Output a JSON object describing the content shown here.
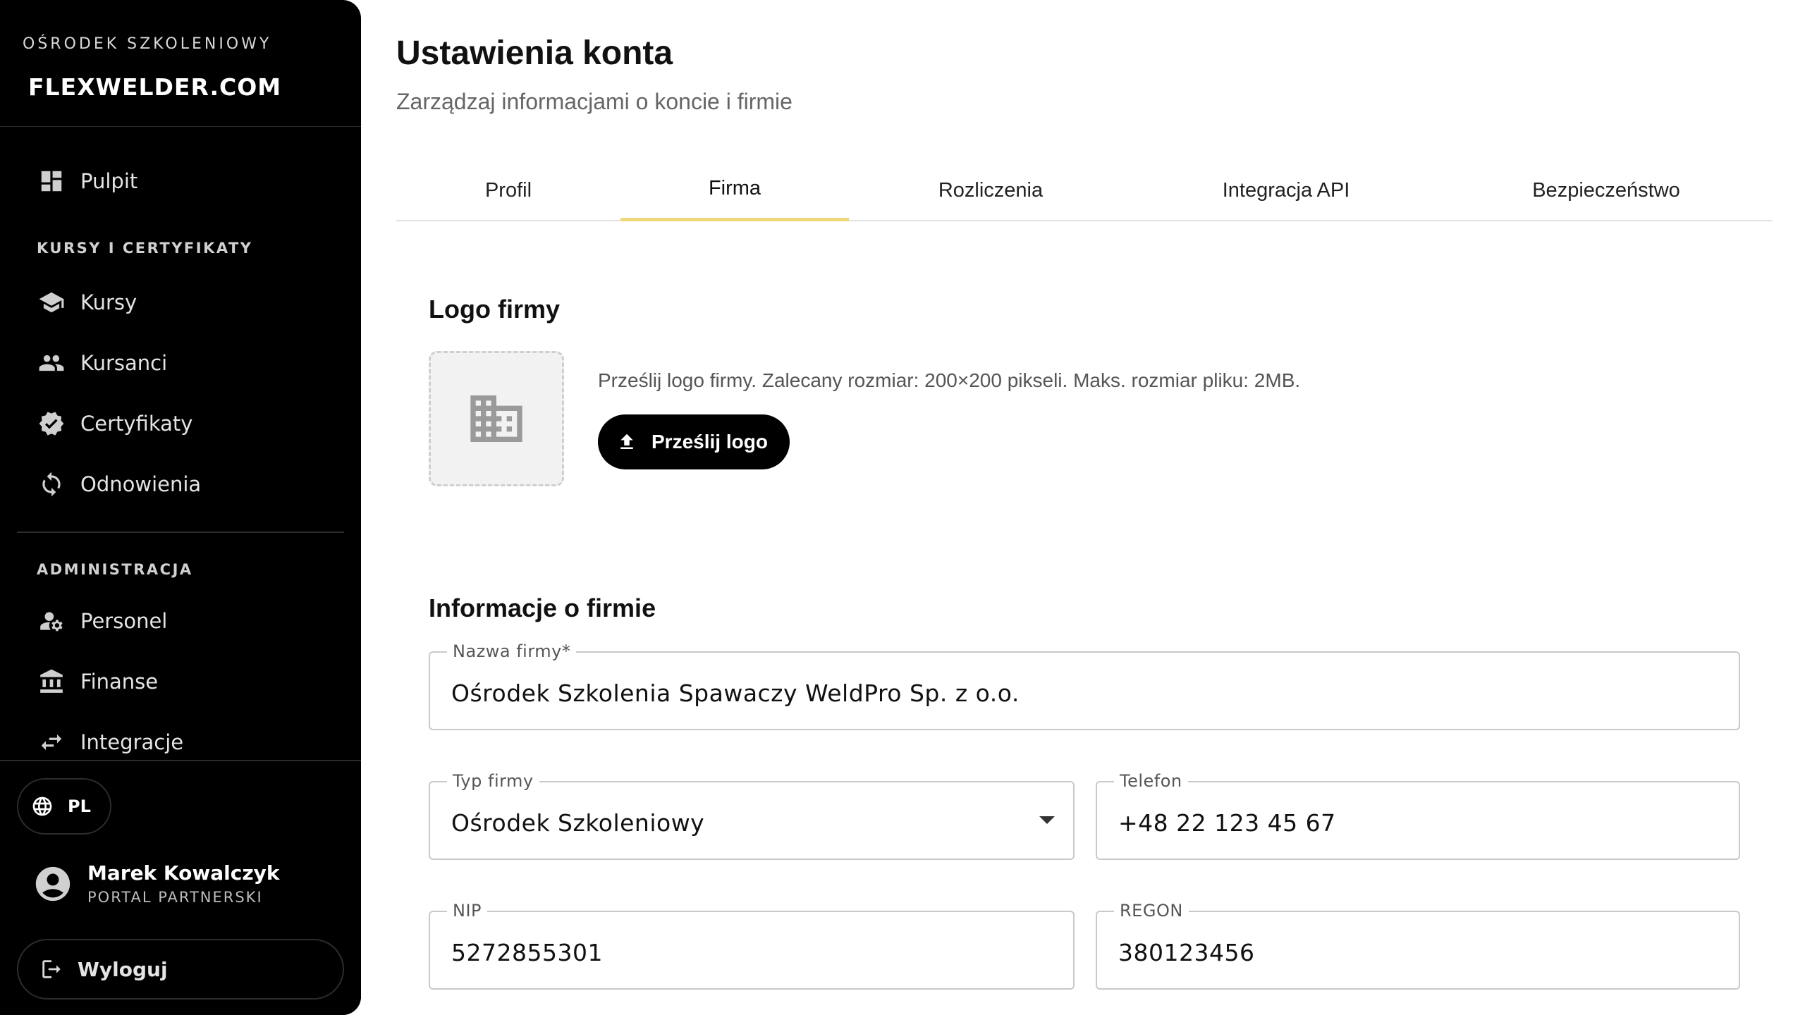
{
  "sidebar": {
    "brand_sub": "OŚRODEK SZKOLENIOWY",
    "brand_logo": "FLEXWELDER.COM",
    "items_top": [
      {
        "label": "Pulpit",
        "icon": "dashboard-icon"
      }
    ],
    "section_courses": "KURSY I CERTYFIKATY",
    "items_courses": [
      {
        "label": "Kursy",
        "icon": "graduation-cap-icon"
      },
      {
        "label": "Kursanci",
        "icon": "people-icon"
      },
      {
        "label": "Certyfikaty",
        "icon": "verified-badge-icon"
      },
      {
        "label": "Odnowienia",
        "icon": "refresh-icon"
      }
    ],
    "section_admin": "ADMINISTRACJA",
    "items_admin": [
      {
        "label": "Personel",
        "icon": "person-settings-icon"
      },
      {
        "label": "Finanse",
        "icon": "bank-icon"
      },
      {
        "label": "Integracje",
        "icon": "swap-icon"
      }
    ],
    "language": "PL",
    "user": {
      "name": "Marek Kowalczyk",
      "role": "PORTAL PARTNERSKI"
    },
    "logout_label": "Wyloguj"
  },
  "header": {
    "title": "Ustawienia konta",
    "subtitle": "Zarządzaj informacjami o koncie i firmie"
  },
  "tabs": [
    {
      "label": "Profil",
      "active": false
    },
    {
      "label": "Firma",
      "active": true
    },
    {
      "label": "Rozliczenia",
      "active": false
    },
    {
      "label": "Integracja API",
      "active": false
    },
    {
      "label": "Bezpieczeństwo",
      "active": false
    }
  ],
  "logo_section": {
    "title": "Logo firmy",
    "hint": "Prześlij logo firmy. Zalecany rozmiar: 200×200 pikseli. Maks. rozmiar pliku: 2MB.",
    "upload_label": "Prześlij logo"
  },
  "company_section": {
    "title": "Informacje o firmie",
    "fields": {
      "company_name": {
        "label": "Nazwa firmy*",
        "value": "Ośrodek Szkolenia Spawaczy WeldPro Sp. z o.o."
      },
      "company_type": {
        "label": "Typ firmy",
        "value": "Ośrodek Szkoleniowy"
      },
      "phone": {
        "label": "Telefon",
        "value": "+48 22 123 45 67"
      },
      "nip": {
        "label": "NIP",
        "value": "5272855301"
      },
      "regon": {
        "label": "REGON",
        "value": "380123456"
      }
    }
  },
  "colors": {
    "sidebar_bg": "#000000",
    "tab_accent": "#f0d77a",
    "primary_button": "#000000"
  }
}
